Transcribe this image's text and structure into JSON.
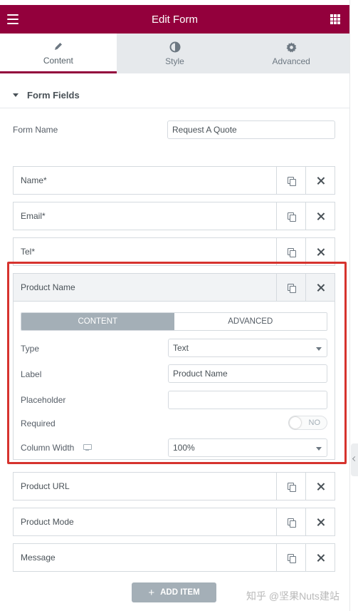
{
  "header": {
    "title": "Edit Form"
  },
  "tabs": [
    {
      "label": "Content",
      "icon": "pencil-icon",
      "active": true
    },
    {
      "label": "Style",
      "icon": "half-circle-icon",
      "active": false
    },
    {
      "label": "Advanced",
      "icon": "gear-icon",
      "active": false
    }
  ],
  "section": {
    "title": "Form Fields"
  },
  "form_name": {
    "label": "Form Name",
    "value": "Request A Quote"
  },
  "fields": [
    {
      "label": "Name*"
    },
    {
      "label": "Email*"
    },
    {
      "label": "Tel*"
    },
    {
      "label": "Product Name"
    },
    {
      "label": "Product URL"
    },
    {
      "label": "Product Mode"
    },
    {
      "label": "Message"
    }
  ],
  "expanded": {
    "seg_content": "CONTENT",
    "seg_advanced": "ADVANCED",
    "type_label": "Type",
    "type_value": "Text",
    "label_label": "Label",
    "label_value": "Product Name",
    "placeholder_label": "Placeholder",
    "placeholder_value": "",
    "required_label": "Required",
    "required_value": "NO",
    "width_label": "Column Width",
    "width_value": "100%"
  },
  "add_item": {
    "label": "ADD ITEM"
  },
  "watermark": "知乎 @坚果Nuts建站",
  "colors": {
    "brand": "#93003c",
    "highlight": "#d6332e",
    "muted": "#a4afb7"
  }
}
